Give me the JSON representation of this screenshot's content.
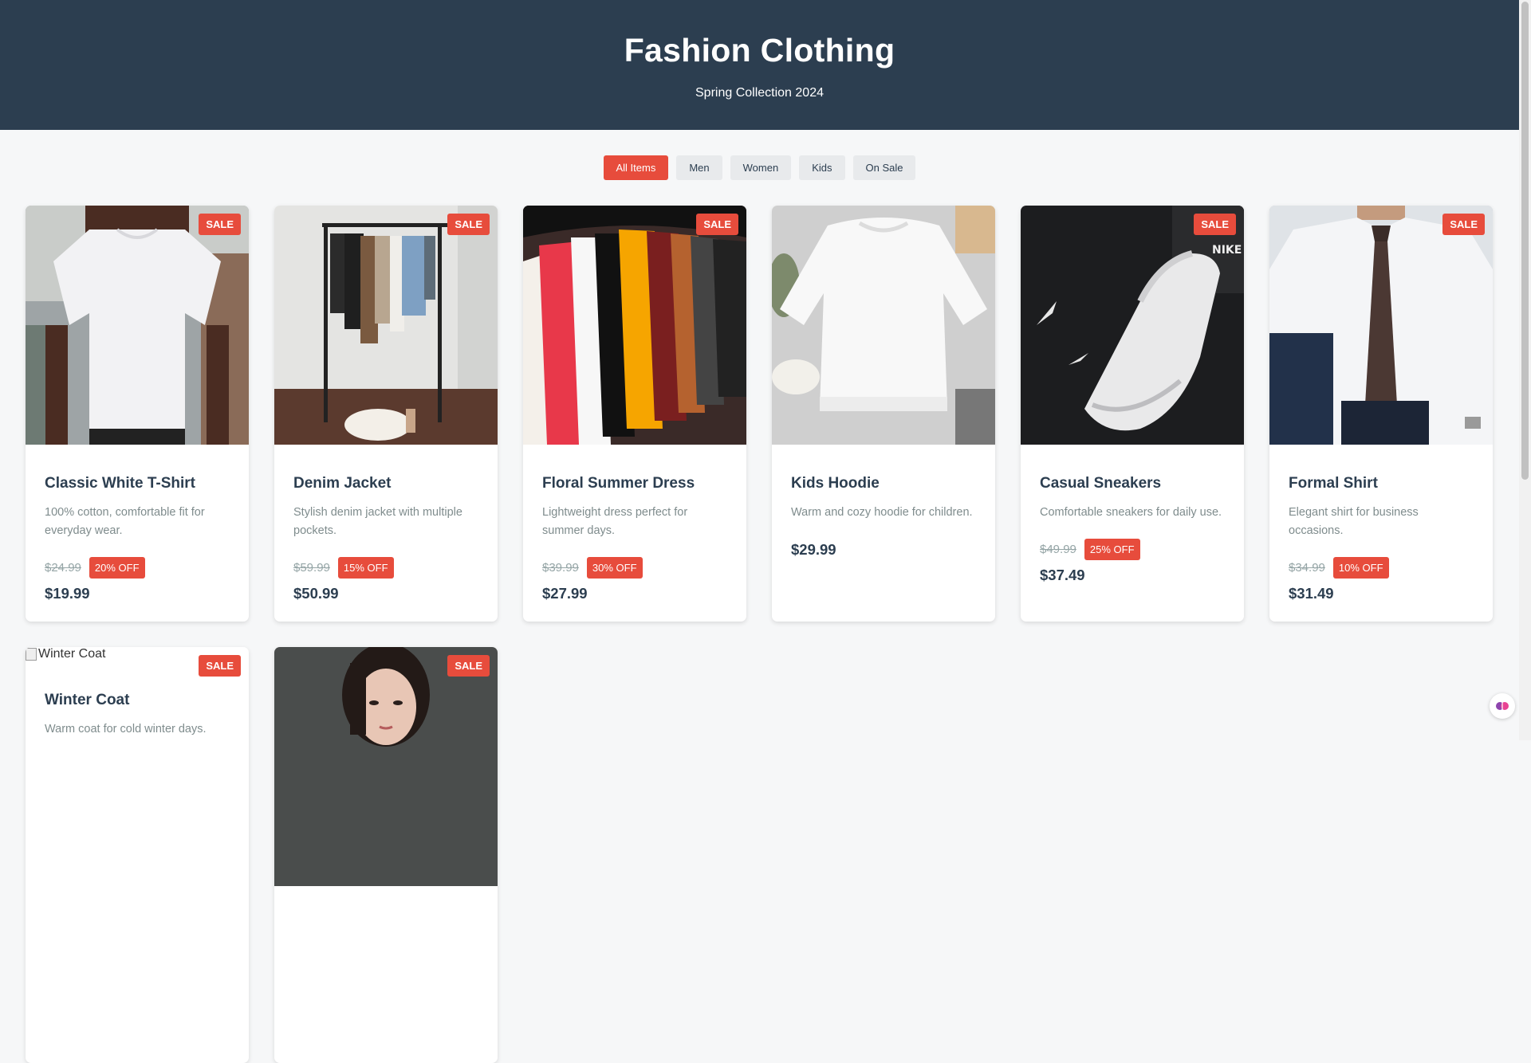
{
  "header": {
    "title": "Fashion Clothing",
    "subtitle": "Spring Collection 2024"
  },
  "filters": [
    "All Items",
    "Men",
    "Women",
    "Kids",
    "On Sale"
  ],
  "active_filter": "All Items",
  "colors": {
    "header_bg": "#2c3e50",
    "accent": "#e74c3c",
    "text_dark": "#2c3e50",
    "text_muted": "#7f8c8d"
  },
  "products": [
    {
      "name": "Classic White T-Shirt",
      "description": "100% cotton, comfortable fit for everyday wear.",
      "badge": "SALE",
      "original_price": "$24.99",
      "discount": "20% OFF",
      "price": "$19.99",
      "image": "white-tshirt-photo"
    },
    {
      "name": "Denim Jacket",
      "description": "Stylish denim jacket with multiple pockets.",
      "badge": "SALE",
      "original_price": "$59.99",
      "discount": "15% OFF",
      "price": "$50.99",
      "image": "clothing-rack-photo"
    },
    {
      "name": "Floral Summer Dress",
      "description": "Lightweight dress perfect for summer days.",
      "badge": "SALE",
      "original_price": "$39.99",
      "discount": "30% OFF",
      "price": "$27.99",
      "image": "colorful-shirts-photo"
    },
    {
      "name": "Kids Hoodie",
      "description": "Warm and cozy hoodie for children.",
      "badge": "",
      "original_price": "",
      "discount": "",
      "price": "$29.99",
      "image": "white-sweatshirt-photo"
    },
    {
      "name": "Casual Sneakers",
      "description": "Comfortable sneakers for daily use.",
      "badge": "SALE",
      "original_price": "$49.99",
      "discount": "25% OFF",
      "price": "$37.49",
      "image": "white-sneaker-photo"
    },
    {
      "name": "Formal Shirt",
      "description": "Elegant shirt for business occasions.",
      "badge": "SALE",
      "original_price": "$34.99",
      "discount": "10% OFF",
      "price": "$31.49",
      "image": "formal-shirt-tie-photo"
    },
    {
      "name": "Winter Coat",
      "description": "Warm coat for cold winter days.",
      "badge": "SALE",
      "image_alt": "Winter Coat",
      "image": "broken-image"
    },
    {
      "name": "",
      "description": "",
      "badge": "SALE",
      "image": "woman-portrait-photo"
    }
  ]
}
